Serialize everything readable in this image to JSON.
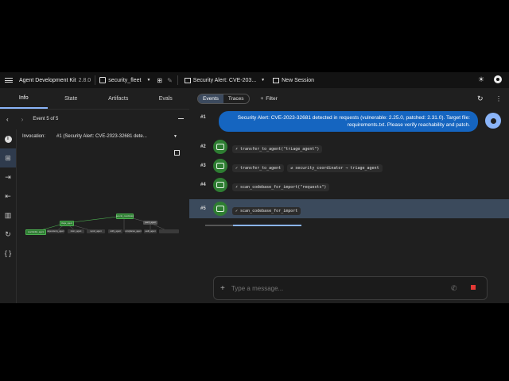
{
  "topbar": {
    "title": "Agent Development Kit",
    "version": "2.8.0",
    "app_select": "security_fleet",
    "session_title": "Security Alert: CVE-203...",
    "new_session": "New Session"
  },
  "left_tabs": [
    "Info",
    "State",
    "Artifacts",
    "Evals"
  ],
  "event_nav": {
    "label": "Event 5 of 5"
  },
  "invocation": {
    "label": "Invocation:",
    "value": "#1 (Security Alert: CVE-2023-32681 dete..."
  },
  "right_header": {
    "tab_events": "Events",
    "tab_traces": "Traces",
    "filter": "Filter"
  },
  "user_message": {
    "num": "#1",
    "text": "Security Alert: CVE-2023-32681 detected in requests (vulnerable: 2.25.0, patched: 2.31.0). Target file: requirements.txt. Please verify reachability and patch."
  },
  "events": [
    {
      "num": "#2",
      "pills": [
        {
          "icon": "bolt",
          "text": "transfer_to_agent(\"triage_agent\")"
        }
      ]
    },
    {
      "num": "#3",
      "pills": [
        {
          "icon": "check",
          "text": "transfer_to_agent"
        },
        {
          "icon": "swap",
          "text": "security_coordinator → triage_agent"
        }
      ]
    },
    {
      "num": "#4",
      "pills": [
        {
          "icon": "bolt",
          "text": "scan_codebase_for_import(\"requests\")"
        }
      ]
    },
    {
      "num": "#5",
      "pills": [
        {
          "icon": "check",
          "text": "scan_codebase_for_import"
        }
      ]
    }
  ],
  "input": {
    "placeholder": "Type a message..."
  },
  "graph": {
    "nodes": [
      "security_coordinator",
      "triage_agent",
      "patch_agent",
      "reachability_agent",
      "dependency_agent",
      "sbom_agent",
      "report_agent",
      "notify_agent",
      "compliance_agent",
      "audit_agent"
    ]
  },
  "colors": {
    "accent": "#8ab4f8",
    "agent_green": "#2e7d32",
    "user_bubble": "#1565c0",
    "selected_row": "#3b4a5c"
  }
}
